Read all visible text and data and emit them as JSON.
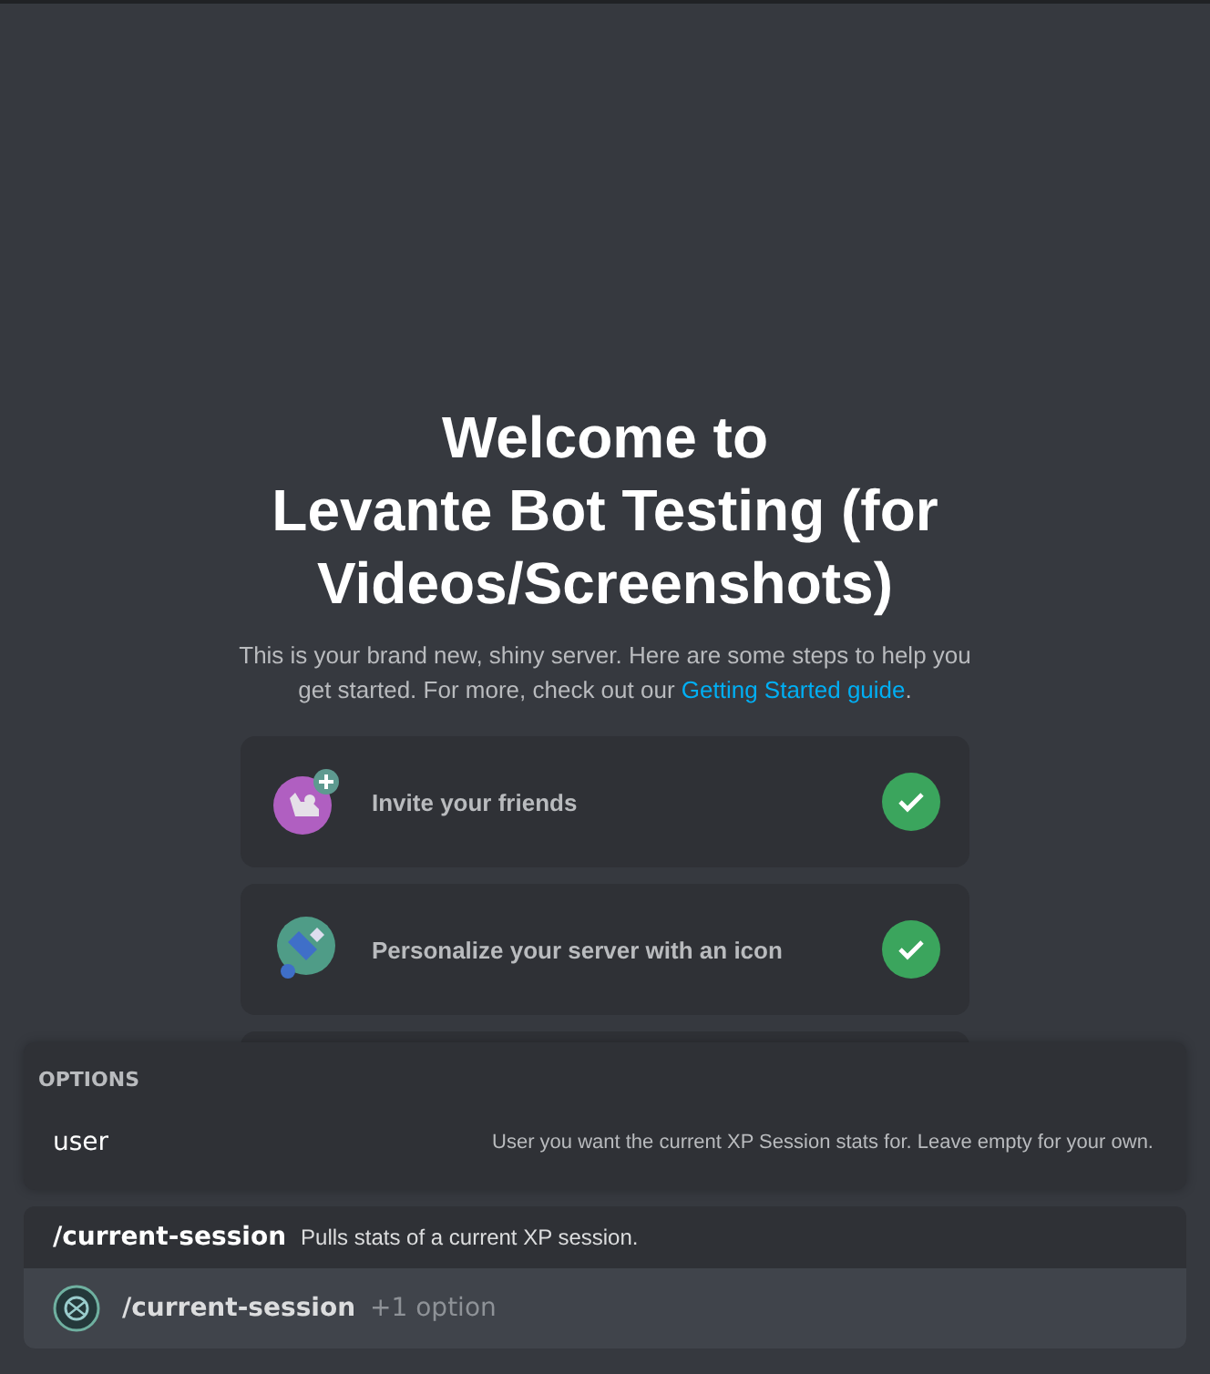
{
  "welcome": {
    "title_lines": [
      "Welcome to",
      "Levante Bot Testing (for",
      "Videos/Screenshots)"
    ],
    "description": {
      "text": "This is your brand new, shiny server. Here are some steps to help you get started. For more, check out our ",
      "link": "Getting Started guide",
      "after": "."
    }
  },
  "steps": [
    {
      "kind": "invite",
      "label": "Invite your friends",
      "done": true
    },
    {
      "kind": "personalize",
      "label": "Personalize your server with an icon",
      "done": true
    }
  ],
  "options_popup": {
    "heading": "OPTIONS",
    "options": [
      {
        "name": "user",
        "description": "User you want the current XP Session stats for. Leave empty for your own."
      }
    ]
  },
  "command_popup": {
    "command": "/current-session",
    "description": "Pulls stats of a current XP session.",
    "items": [
      {
        "command": "/current-session",
        "extra": "+1 option",
        "selected": true
      }
    ]
  }
}
